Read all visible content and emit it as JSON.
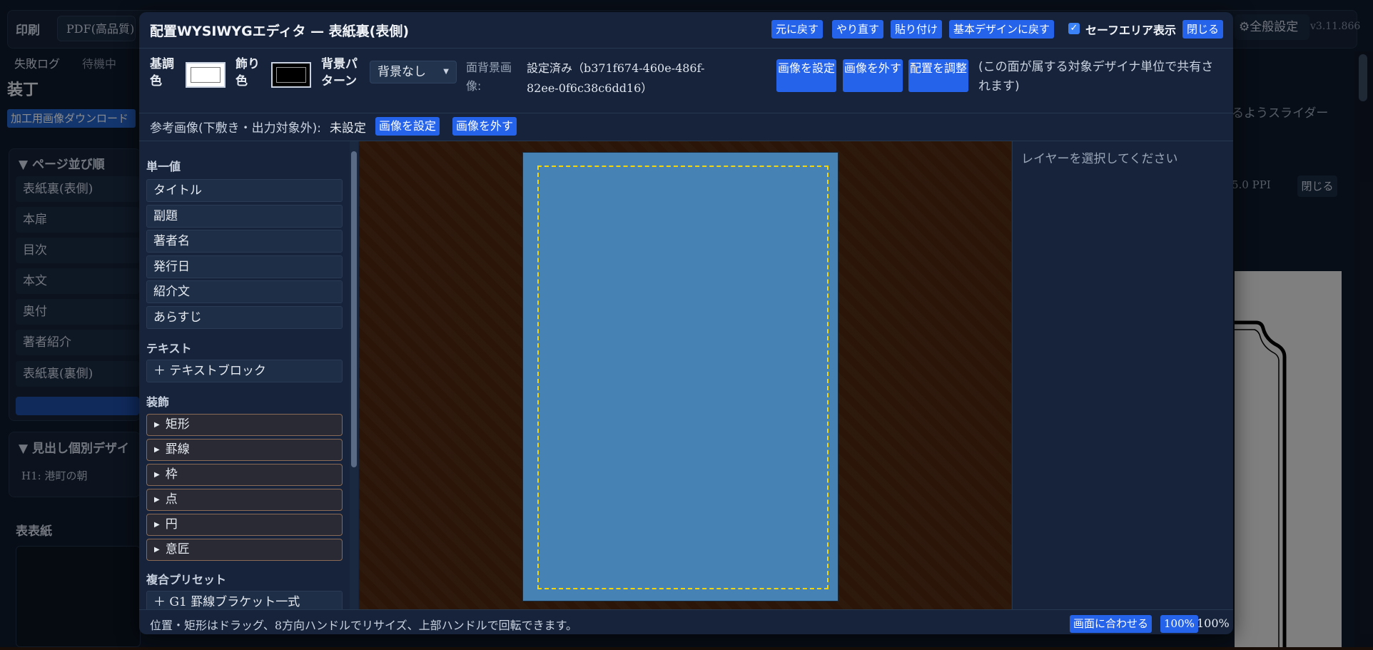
{
  "background_app": {
    "print_label": "印刷",
    "pdf_select": "PDF(高品質)",
    "settings_label": "⚙全般設定",
    "version": "v3.11.866",
    "tabs": [
      "失敗ログ",
      "待機中"
    ],
    "heading": "装丁",
    "download_button": "加工用画像ダウンロード",
    "page_order_title": "ページ並び順",
    "page_items": [
      "表紙裏(表側)",
      "本扉",
      "目次",
      "本文",
      "奥付",
      "著者紹介",
      "表紙裏(裏側)"
    ],
    "heading_design_title": "見出し個別デザイ",
    "h1_item": "H1: 港町の朝",
    "cover_title": "表表紙",
    "right_text": "るようスライダー",
    "ppi_text": "5.0 PPI",
    "close_label": "閉じる"
  },
  "modal": {
    "title": "配置WYSIWYGエディタ — 表紙裏(表側)",
    "header_buttons": {
      "undo": "元に戻す",
      "redo": "やり直す",
      "paste": "貼り付け",
      "reset_design": "基本デザインに戻す",
      "close": "閉じる"
    },
    "safe_area": {
      "label": "セーフエリア表示",
      "checked": true
    },
    "base_color_label": "基調色",
    "base_color": "#ffffff",
    "accent_color_label": "飾り色",
    "accent_color": "#000000",
    "pattern_label": "背景パターン",
    "pattern_value": "背景なし",
    "bg_image_label": "面背景画像:",
    "bg_image_value": "設定済み（b371f674-460e-486f-82ee-0f6c38c6dd16）",
    "set_image_button": "画像を設定",
    "remove_image_button": "画像を外す",
    "adjust_button": "配置を調整",
    "share_note": "(この面が属する対象デザイナ単位で共有されます)",
    "ref_image_label": "参考画像(下敷き・出力対象外):",
    "ref_image_status": "未設定",
    "ref_set_button": "画像を設定",
    "ref_remove_button": "画像を外す",
    "palette": {
      "single_title": "単一値",
      "single_items": [
        "タイトル",
        "副題",
        "著者名",
        "発行日",
        "紹介文",
        "あらすじ"
      ],
      "text_title": "テキスト",
      "text_items": [
        "＋ テキストブロック"
      ],
      "deco_title": "装飾",
      "deco_items": [
        "矩形",
        "罫線",
        "枠",
        "点",
        "円",
        "意匠"
      ],
      "preset_title": "複合プリセット",
      "preset_items": [
        "＋ G1 罫線ブラケット一式"
      ]
    },
    "page_color": "#4682b4",
    "inspector_placeholder": "レイヤーを選択してください",
    "footer_hint": "位置・矩形はドラッグ、8方向ハンドルでリサイズ、上部ハンドルで回転できます。",
    "fit_button": "画面に合わせる",
    "zoom_button": "100%",
    "zoom_value": "100%"
  }
}
